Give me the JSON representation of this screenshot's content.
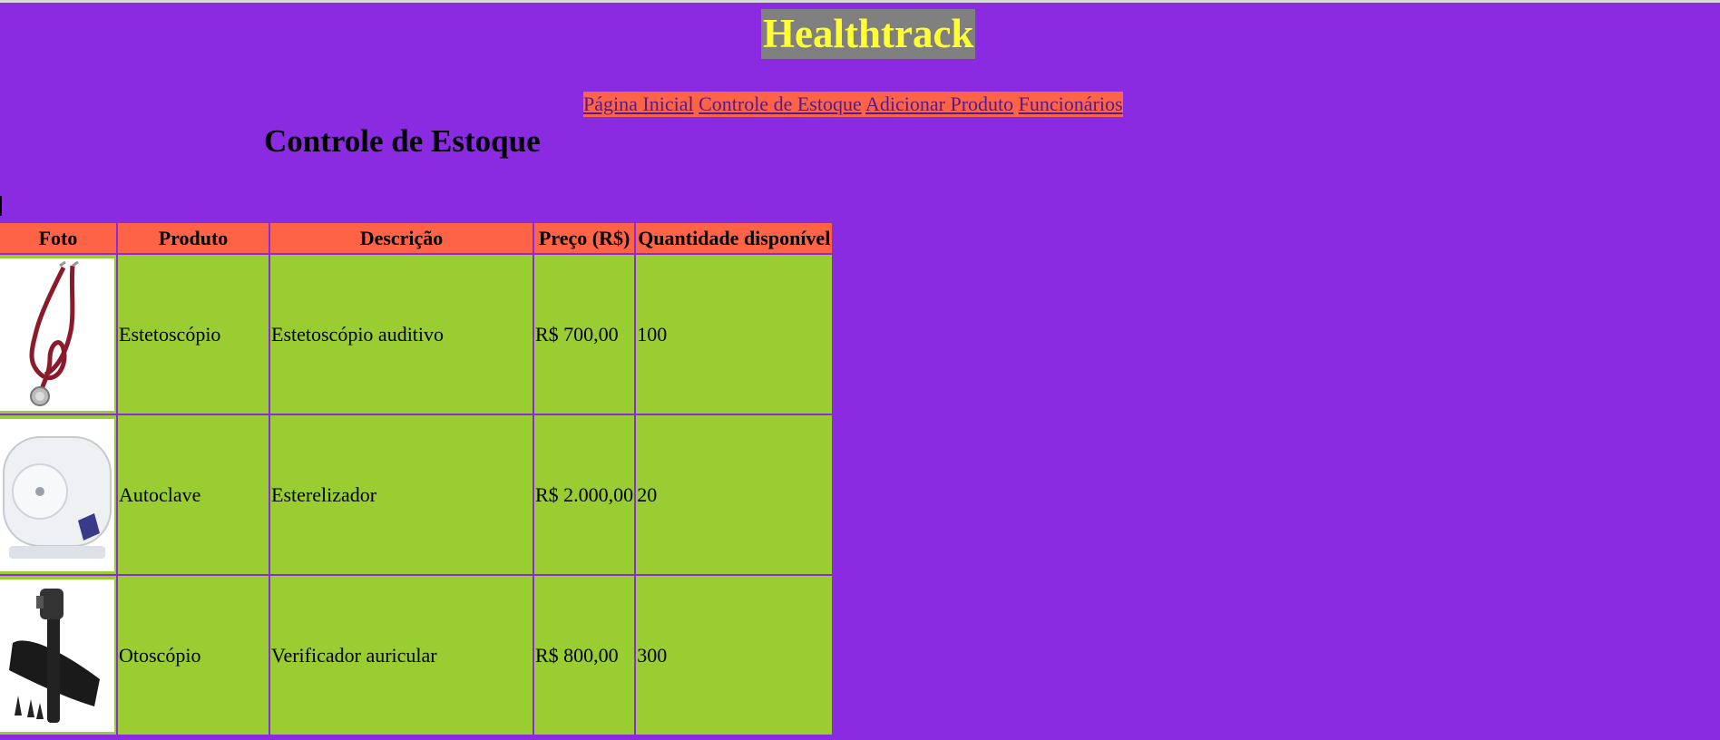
{
  "header": {
    "title": "Healthtrack"
  },
  "nav": {
    "items": [
      {
        "label": "Página Inicial"
      },
      {
        "label": "Controle de Estoque"
      },
      {
        "label": "Adicionar Produto"
      },
      {
        "label": "Funcionários"
      }
    ]
  },
  "main": {
    "heading": "Controle de Estoque",
    "table": {
      "columns": [
        "Foto",
        "Produto",
        "Descrição",
        "Preço (R$)",
        "Quantidade disponível"
      ],
      "rows": [
        {
          "photo_icon": "stethoscope-image",
          "produto": "Estetoscópio",
          "descricao": "Estetoscópio auditivo",
          "preco": "R$ 700,00",
          "quantidade": "100"
        },
        {
          "photo_icon": "autoclave-image",
          "produto": "Autoclave",
          "descricao": "Esterelizador",
          "preco": "R$ 2.000,00",
          "quantidade": "20"
        },
        {
          "photo_icon": "otoscope-image",
          "produto": "Otoscópio",
          "descricao": "Verificador auricular",
          "preco": "R$ 800,00",
          "quantidade": "300"
        }
      ]
    }
  },
  "colors": {
    "background": "#8a2be2",
    "title_bg": "#808080",
    "title_text": "#ffff33",
    "accent": "#ff6347",
    "cell_bg": "#9acd32",
    "link": "#551a8b"
  }
}
